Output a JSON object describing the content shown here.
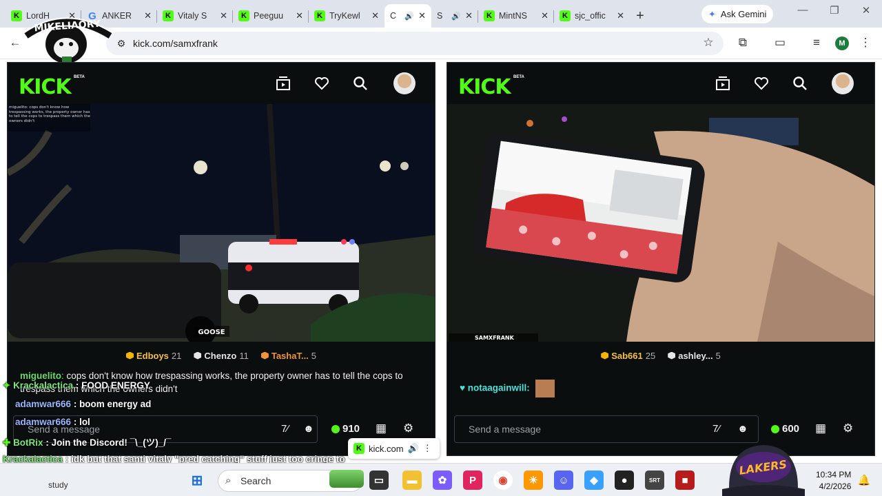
{
  "tabs": [
    {
      "title": "LordH",
      "icon": "kick-icon"
    },
    {
      "title": "ANKER",
      "icon": "google-icon"
    },
    {
      "title": "Vitaly S",
      "icon": "kick-icon"
    },
    {
      "title": "Peeguu",
      "icon": "kick-icon"
    },
    {
      "title": "TryKewl",
      "icon": "kick-icon"
    },
    {
      "title": "C",
      "icon": "kick-icon"
    },
    {
      "title": "S",
      "icon": "kick-icon"
    },
    {
      "title": "MintNS",
      "icon": "kick-icon"
    },
    {
      "title": "sjc_offic",
      "icon": "kick-icon"
    }
  ],
  "gemini": {
    "label": "Ask Gemini"
  },
  "address": {
    "url": "kick.com/samxfrank"
  },
  "profile_initial": "M",
  "overlay_logo": {
    "text": "MIKELIAORY"
  },
  "left_pane": {
    "video_overlay_chat": "miguelito: cops don't know how trespassing works, the property owner has to tell the cops to trespass them which the owners didn't",
    "video_watermark": "GOOSE",
    "top_chatters": [
      {
        "name": "Edboys",
        "count": "21",
        "badge": "gold"
      },
      {
        "name": "Chenzo",
        "count": "11",
        "badge": "white"
      },
      {
        "name": "TashaT...",
        "count": "5",
        "badge": "orange"
      }
    ],
    "chat": {
      "name": "miguelito",
      "text": "cops don't know how trespassing works, the property owner has to tell the cops to trespass them which the owners didn't"
    },
    "send_placeholder": "Send a message",
    "points": "910"
  },
  "right_pane": {
    "video_overlay_tag": "SAMXFRANK",
    "top_chatters": [
      {
        "name": "Sab661",
        "count": "25",
        "badge": "gold"
      },
      {
        "name": "ashley...",
        "count": "5",
        "badge": "white"
      }
    ],
    "chat": {
      "name": "notaagainwill:",
      "text": ""
    },
    "send_placeholder": "Send a message",
    "points": "600"
  },
  "overlay_chat": [
    {
      "name": "Krackalactica",
      "text": "FOOD ENERGY"
    },
    {
      "name": "adamwar666",
      "text": "boom energy ad"
    },
    {
      "name": "adamwar666",
      "text": "lol"
    },
    {
      "name": "BotRix",
      "text": "Join the Discord! ¯\\_(ツ)_/¯"
    },
    {
      "name": "Krackalactica",
      "text": "idk but that santi vitaly \"pred catching\" stuff just too cringe to watch. hate peedos but idk since they're not cops it's just weird in a cringe way entraping people"
    }
  ],
  "mini_tab": {
    "label": "kick.com"
  },
  "taskbar": {
    "search_label": "Search",
    "time": "10:34 PM",
    "date": "4/2/2026",
    "study_text": "study"
  },
  "colors": {
    "kick_green": "#53fc18",
    "bg_dark": "#0b0e0f",
    "gold": "#f5c04a"
  }
}
